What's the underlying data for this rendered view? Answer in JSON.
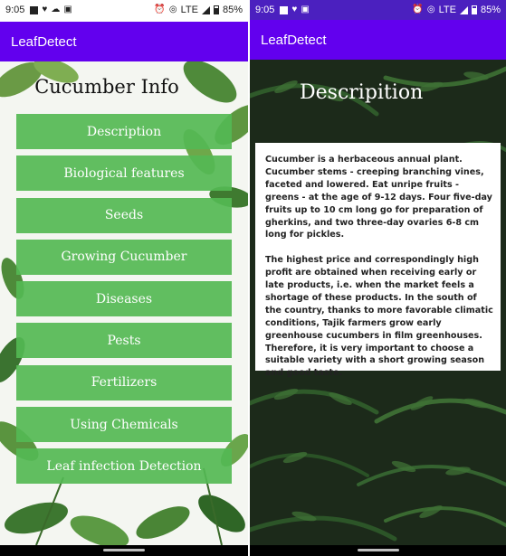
{
  "left_screen": {
    "status_bar": {
      "time": "9:05",
      "network": "LTE",
      "battery": "85%"
    },
    "app_bar": {
      "title": "LeafDetect"
    },
    "heading": "Cucumber Info",
    "menu": [
      {
        "label": "Description"
      },
      {
        "label": "Biological features"
      },
      {
        "label": "Seeds"
      },
      {
        "label": "Growing Cucumber"
      },
      {
        "label": "Diseases"
      },
      {
        "label": "Pests"
      },
      {
        "label": "Fertilizers"
      },
      {
        "label": "Using Chemicals"
      },
      {
        "label": "Leaf infection Detection"
      }
    ],
    "colors": {
      "menu_button": "#54b854",
      "app_bar": "#6200ee"
    }
  },
  "right_screen": {
    "status_bar": {
      "time": "9:05",
      "network": "LTE",
      "battery": "85%"
    },
    "app_bar": {
      "title": "LeafDetect"
    },
    "heading": "Descripition",
    "paragraphs": [
      "Cucumber is a herbaceous annual plant. Cucumber stems - creeping branching vines, faceted and lowered. Eat unripe fruits - greens - at the age of 9-12 days. Four five-day fruits up to 10 cm long go for preparation of gherkins, and two three-day ovaries 6-8 cm long for pickles.",
      "The highest price and correspondingly high profit are obtained when receiving early or late products, i.e. when the market feels a shortage of these products. In the south of the country, thanks to more favorable climatic conditions, Tajik farmers grow early greenhouse cucumbers in film greenhouses. Therefore, it is very important to choose a suitable variety with a short growing season and good taste."
    ],
    "colors": {
      "status_bar": "#4b20bf",
      "app_bar": "#6200ee"
    }
  }
}
